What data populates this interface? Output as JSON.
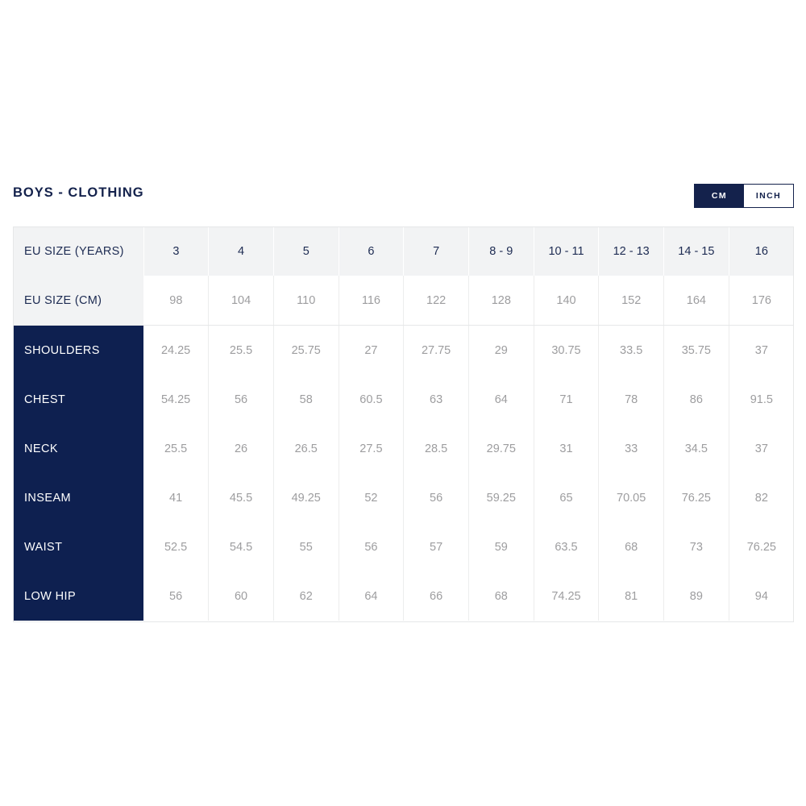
{
  "header": {
    "title": "BOYS - CLOTHING",
    "unit_toggle": {
      "cm_label": "CM",
      "inch_label": "INCH",
      "active": "CM"
    }
  },
  "colors": {
    "navy": "#0e2050",
    "title_navy": "#14224c",
    "header_row_bg": "#f2f3f4",
    "cell_text_gray": "#9d9d9f",
    "grid_line": "#eceded"
  },
  "table": {
    "size_rows": [
      {
        "label": "EU SIZE (YEARS)",
        "values": [
          "3",
          "4",
          "5",
          "6",
          "7",
          "8 - 9",
          "10 - 11",
          "12 - 13",
          "14 - 15",
          "16"
        ]
      },
      {
        "label": "EU SIZE (CM)",
        "values": [
          "98",
          "104",
          "110",
          "116",
          "122",
          "128",
          "140",
          "152",
          "164",
          "176"
        ]
      }
    ],
    "measurement_rows": [
      {
        "label": "SHOULDERS",
        "values": [
          "24.25",
          "25.5",
          "25.75",
          "27",
          "27.75",
          "29",
          "30.75",
          "33.5",
          "35.75",
          "37"
        ]
      },
      {
        "label": "CHEST",
        "values": [
          "54.25",
          "56",
          "58",
          "60.5",
          "63",
          "64",
          "71",
          "78",
          "86",
          "91.5"
        ]
      },
      {
        "label": "NECK",
        "values": [
          "25.5",
          "26",
          "26.5",
          "27.5",
          "28.5",
          "29.75",
          "31",
          "33",
          "34.5",
          "37"
        ]
      },
      {
        "label": "INSEAM",
        "values": [
          "41",
          "45.5",
          "49.25",
          "52",
          "56",
          "59.25",
          "65",
          "70.05",
          "76.25",
          "82"
        ]
      },
      {
        "label": "WAIST",
        "values": [
          "52.5",
          "54.5",
          "55",
          "56",
          "57",
          "59",
          "63.5",
          "68",
          "73",
          "76.25"
        ]
      },
      {
        "label": "LOW HIP",
        "values": [
          "56",
          "60",
          "62",
          "64",
          "66",
          "68",
          "74.25",
          "81",
          "89",
          "94"
        ]
      }
    ]
  },
  "chart_data": {
    "type": "table",
    "title": "BOYS - CLOTHING",
    "unit": "CM",
    "columns": [
      "EU SIZE (YEARS)",
      "3",
      "4",
      "5",
      "6",
      "7",
      "8 - 9",
      "10 - 11",
      "12 - 13",
      "14 - 15",
      "16"
    ],
    "eu_size_cm": [
      "98",
      "104",
      "110",
      "116",
      "122",
      "128",
      "140",
      "152",
      "164",
      "176"
    ],
    "rows": [
      {
        "measurement": "SHOULDERS",
        "values": [
          24.25,
          25.5,
          25.75,
          27,
          27.75,
          29,
          30.75,
          33.5,
          35.75,
          37
        ]
      },
      {
        "measurement": "CHEST",
        "values": [
          54.25,
          56,
          58,
          60.5,
          63,
          64,
          71,
          78,
          86,
          91.5
        ]
      },
      {
        "measurement": "NECK",
        "values": [
          25.5,
          26,
          26.5,
          27.5,
          28.5,
          29.75,
          31,
          33,
          34.5,
          37
        ]
      },
      {
        "measurement": "INSEAM",
        "values": [
          41,
          45.5,
          49.25,
          52,
          56,
          59.25,
          65,
          70.05,
          76.25,
          82
        ]
      },
      {
        "measurement": "WAIST",
        "values": [
          52.5,
          54.5,
          55,
          56,
          57,
          59,
          63.5,
          68,
          73,
          76.25
        ]
      },
      {
        "measurement": "LOW HIP",
        "values": [
          56,
          60,
          62,
          64,
          66,
          68,
          74.25,
          81,
          89,
          94
        ]
      }
    ]
  }
}
